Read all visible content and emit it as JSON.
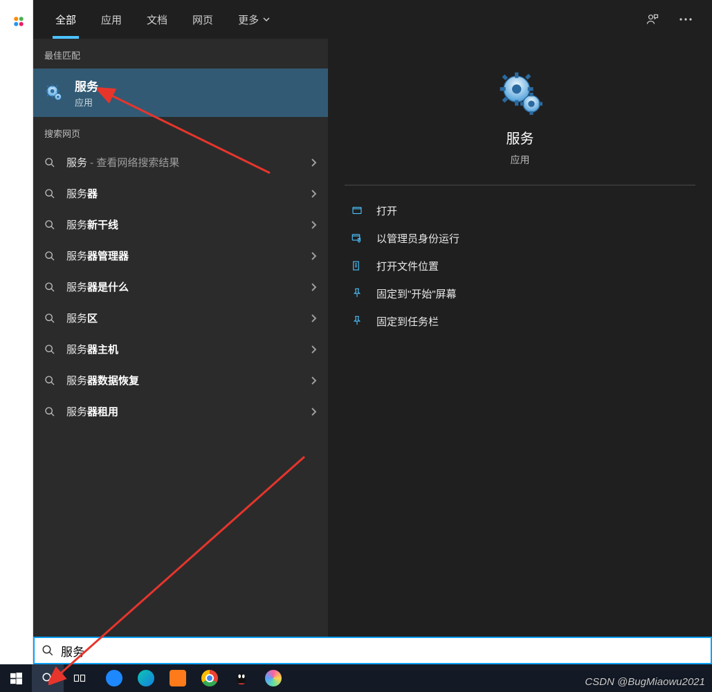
{
  "tabs": {
    "all": "全部",
    "apps": "应用",
    "docs": "文档",
    "web": "网页",
    "more": "更多"
  },
  "sections": {
    "best_match": "最佳匹配",
    "search_web": "搜索网页"
  },
  "best_match": {
    "title": "服务",
    "subtitle": "应用"
  },
  "web_results": [
    {
      "pre": "服务 ",
      "dim": "- 查看网络搜索结果",
      "bold": ""
    },
    {
      "pre": "服务",
      "dim": "",
      "bold": "器"
    },
    {
      "pre": "服务",
      "dim": "",
      "bold": "新干线"
    },
    {
      "pre": "服务",
      "dim": "",
      "bold": "器管理器"
    },
    {
      "pre": "服务",
      "dim": "",
      "bold": "器是什么"
    },
    {
      "pre": "服务",
      "dim": "",
      "bold": "区"
    },
    {
      "pre": "服务",
      "dim": "",
      "bold": "器主机"
    },
    {
      "pre": "服务",
      "dim": "",
      "bold": "器数据恢复"
    },
    {
      "pre": "服务",
      "dim": "",
      "bold": "器租用"
    }
  ],
  "preview": {
    "title": "服务",
    "subtitle": "应用"
  },
  "actions": {
    "open": "打开",
    "run_admin": "以管理员身份运行",
    "open_location": "打开文件位置",
    "pin_start": "固定到\"开始\"屏幕",
    "pin_taskbar": "固定到任务栏"
  },
  "search": {
    "value": "服务"
  },
  "watermark": "CSDN @BugMiaowu2021"
}
